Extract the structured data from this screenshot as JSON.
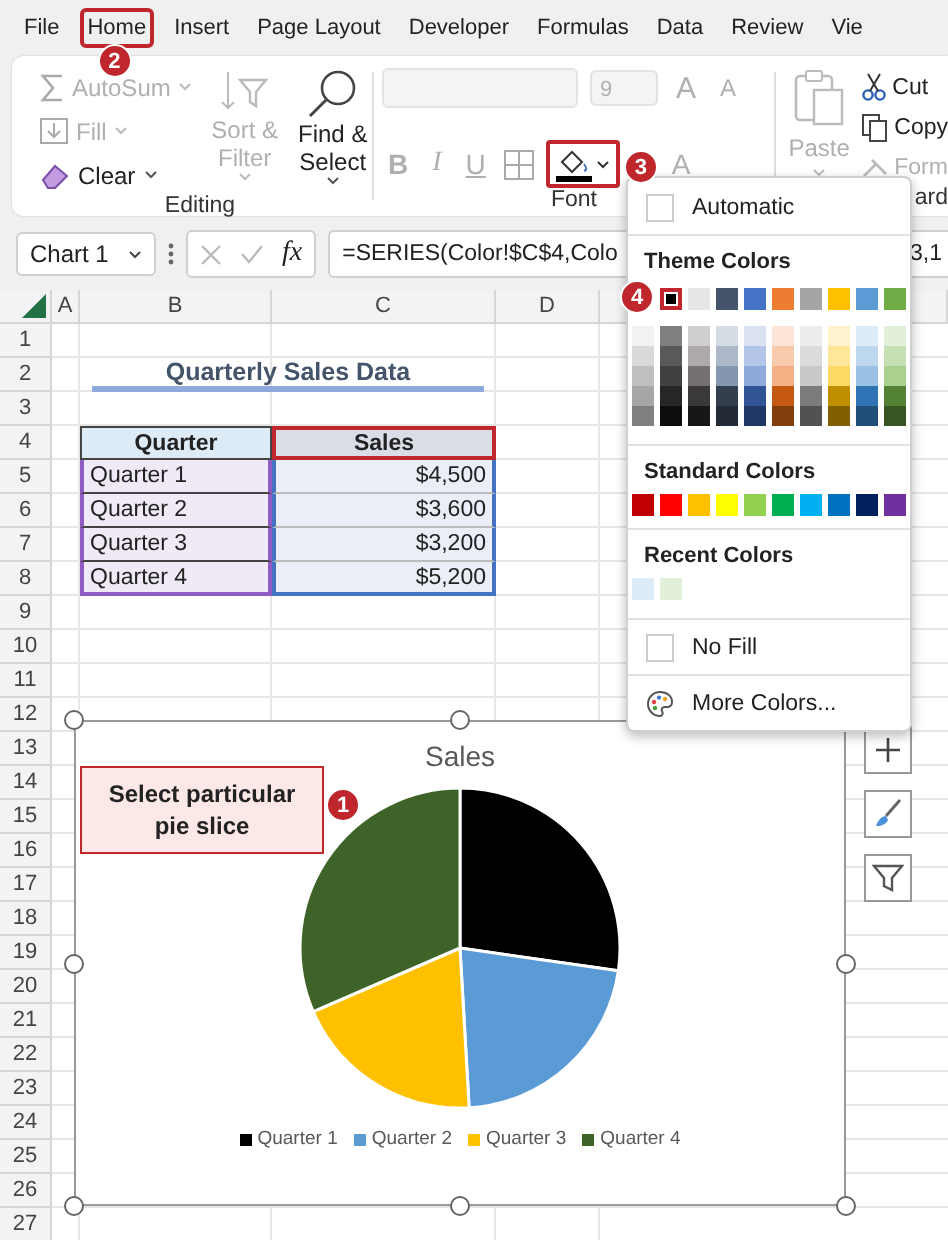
{
  "menu_tabs": [
    {
      "label": "File",
      "selected": false
    },
    {
      "label": "Home",
      "selected": true,
      "step": "2"
    },
    {
      "label": "Insert",
      "selected": false
    },
    {
      "label": "Page Layout",
      "selected": false
    },
    {
      "label": "Developer",
      "selected": false
    },
    {
      "label": "Formulas",
      "selected": false
    },
    {
      "label": "Data",
      "selected": false
    },
    {
      "label": "Review",
      "selected": false
    },
    {
      "label": "Vie",
      "selected": false
    }
  ],
  "editing_group": {
    "label": "Editing",
    "buttons": [
      {
        "kind": "autosum",
        "label": "AutoSum",
        "disabled": true
      },
      {
        "kind": "fill",
        "label": "Fill",
        "disabled": true
      },
      {
        "kind": "clear",
        "label": "Clear",
        "disabled": false
      },
      {
        "kind": "sort_filter",
        "label": "Sort & Filter",
        "disabled": true
      },
      {
        "kind": "find_select",
        "label": "Find & Select",
        "disabled": false
      }
    ]
  },
  "font_group": {
    "label": "Font",
    "font_name": {
      "disabled": true
    },
    "font_size": {
      "value": "9",
      "disabled": true
    },
    "size_buttons": [
      {
        "kind": "grow",
        "label": "A",
        "disabled": true
      },
      {
        "kind": "shrink",
        "label": "A",
        "disabled": true
      }
    ],
    "format_buttons": [
      {
        "kind": "bold",
        "label": "B",
        "disabled": true
      },
      {
        "kind": "italic",
        "label": "I",
        "disabled": true
      },
      {
        "kind": "underline",
        "label": "U",
        "disabled": true
      }
    ],
    "fill_color": {
      "color": "#000000",
      "expanded": true,
      "step": "3"
    },
    "font_color": {
      "label": "A",
      "disabled": true
    }
  },
  "clipboard_group": {
    "label": "ard",
    "buttons": [
      {
        "kind": "paste",
        "label": "Paste",
        "disabled": true
      },
      {
        "kind": "cut",
        "label": "Cut",
        "disabled": false
      },
      {
        "kind": "copy",
        "label": "Copy",
        "disabled": false
      },
      {
        "kind": "format_painter",
        "label": "Form",
        "disabled": true
      }
    ]
  },
  "formula_bar": {
    "name_box": "Chart 1",
    "function_label": "fx",
    "formula": "=SERIES(Color!$C$4,Colo",
    "formula_tail": "3,1"
  },
  "sheet": {
    "columns": [
      "A",
      "B",
      "C",
      "D"
    ],
    "rows": [
      "1",
      "2",
      "3",
      "4",
      "5",
      "6",
      "7",
      "8",
      "9",
      "10",
      "11",
      "12",
      "13",
      "14",
      "15",
      "16",
      "17",
      "18",
      "19",
      "20",
      "21",
      "22",
      "23",
      "24",
      "25",
      "26",
      "27"
    ],
    "title": "Quarterly Sales Data",
    "table": {
      "columns": [
        "Quarter",
        "Sales"
      ],
      "rows": [
        [
          "Quarter 1",
          "$4,500"
        ],
        [
          "Quarter 2",
          "$3,600"
        ],
        [
          "Quarter 3",
          "$3,200"
        ],
        [
          "Quarter 4",
          "$5,200"
        ]
      ]
    }
  },
  "chart": {
    "selected": true,
    "chart_data": {
      "type": "pie",
      "title": "Sales",
      "categories": [
        "Quarter 1",
        "Quarter 2",
        "Quarter 3",
        "Quarter 4"
      ],
      "legend": "bottom",
      "series": [
        {
          "values": [
            27.27,
            21.82,
            19.39,
            31.52
          ]
        }
      ],
      "colors": [
        "#000000",
        "#5b9bd5",
        "#ffc000",
        "#3e6328"
      ]
    },
    "callout": {
      "text": "Select particular pie slice",
      "step": "1"
    },
    "tools": [
      {
        "kind": "elements"
      },
      {
        "kind": "styles"
      },
      {
        "kind": "filters"
      }
    ]
  },
  "color_menu": {
    "automatic": "Automatic",
    "sections": [
      {
        "kind": "theme",
        "title": "Theme Colors",
        "colors": [
          {
            "shades": [
              {
                "color": "#f2f2f2"
              },
              {
                "color": "#d9d9d9"
              },
              {
                "color": "#bfbfbf"
              },
              {
                "color": "#a6a6a6"
              },
              {
                "color": "#808080"
              }
            ]
          },
          {
            "color": "#000000",
            "selected": true,
            "step": "4",
            "shades": [
              {
                "color": "#808080"
              },
              {
                "color": "#595959"
              },
              {
                "color": "#404040"
              },
              {
                "color": "#262626"
              },
              {
                "color": "#0d0d0d"
              }
            ]
          },
          {
            "color": "#e7e6e6",
            "selected": false,
            "shades": [
              {
                "color": "#d0cece"
              },
              {
                "color": "#aeaaaa"
              },
              {
                "color": "#757171"
              },
              {
                "color": "#3a3838"
              },
              {
                "color": "#171616"
              }
            ]
          },
          {
            "color": "#44546a",
            "selected": false,
            "shades": [
              {
                "color": "#d6dce4"
              },
              {
                "color": "#adb9ca"
              },
              {
                "color": "#8497b0"
              },
              {
                "color": "#333f4f"
              },
              {
                "color": "#222b35"
              }
            ]
          },
          {
            "color": "#4472c4",
            "selected": false,
            "shades": [
              {
                "color": "#d9e1f2"
              },
              {
                "color": "#b4c6e7"
              },
              {
                "color": "#8ea9db"
              },
              {
                "color": "#305496"
              },
              {
                "color": "#203764"
              }
            ]
          },
          {
            "color": "#ed7d31",
            "selected": false,
            "shades": [
              {
                "color": "#fce4d6"
              },
              {
                "color": "#f8cbad"
              },
              {
                "color": "#f4b084"
              },
              {
                "color": "#c65911"
              },
              {
                "color": "#833c0c"
              }
            ]
          },
          {
            "color": "#a5a5a5",
            "selected": false,
            "shades": [
              {
                "color": "#ededed"
              },
              {
                "color": "#dbdbdb"
              },
              {
                "color": "#c9c9c9"
              },
              {
                "color": "#7b7b7b"
              },
              {
                "color": "#525252"
              }
            ]
          },
          {
            "color": "#ffc000",
            "selected": false,
            "shades": [
              {
                "color": "#fff2cc"
              },
              {
                "color": "#ffe699"
              },
              {
                "color": "#ffd966"
              },
              {
                "color": "#bf8f00"
              },
              {
                "color": "#806000"
              }
            ]
          },
          {
            "color": "#5b9bd5",
            "selected": false,
            "shades": [
              {
                "color": "#ddebf7"
              },
              {
                "color": "#bdd7ee"
              },
              {
                "color": "#9bc2e6"
              },
              {
                "color": "#2f75b5"
              },
              {
                "color": "#1f4e78"
              }
            ]
          },
          {
            "color": "#70ad47",
            "selected": false,
            "shades": [
              {
                "color": "#e2efda"
              },
              {
                "color": "#c6e0b4"
              },
              {
                "color": "#a9d08e"
              },
              {
                "color": "#548235"
              },
              {
                "color": "#375623"
              }
            ]
          }
        ]
      },
      {
        "kind": "standard",
        "title": "Standard Colors",
        "colors": [
          {
            "color": "#c00000"
          },
          {
            "color": "#ff0000"
          },
          {
            "color": "#ffc000"
          },
          {
            "color": "#ffff00"
          },
          {
            "color": "#92d050"
          },
          {
            "color": "#00b050"
          },
          {
            "color": "#00b0f0"
          },
          {
            "color": "#0070c0"
          },
          {
            "color": "#002060"
          },
          {
            "color": "#7030a0"
          }
        ]
      },
      {
        "kind": "recent",
        "title": "Recent Colors",
        "colors": [
          {
            "color": "#ddebf7"
          },
          {
            "color": "#e2efda"
          }
        ]
      }
    ],
    "no_fill": "No Fill",
    "more_colors": "More Colors..."
  }
}
